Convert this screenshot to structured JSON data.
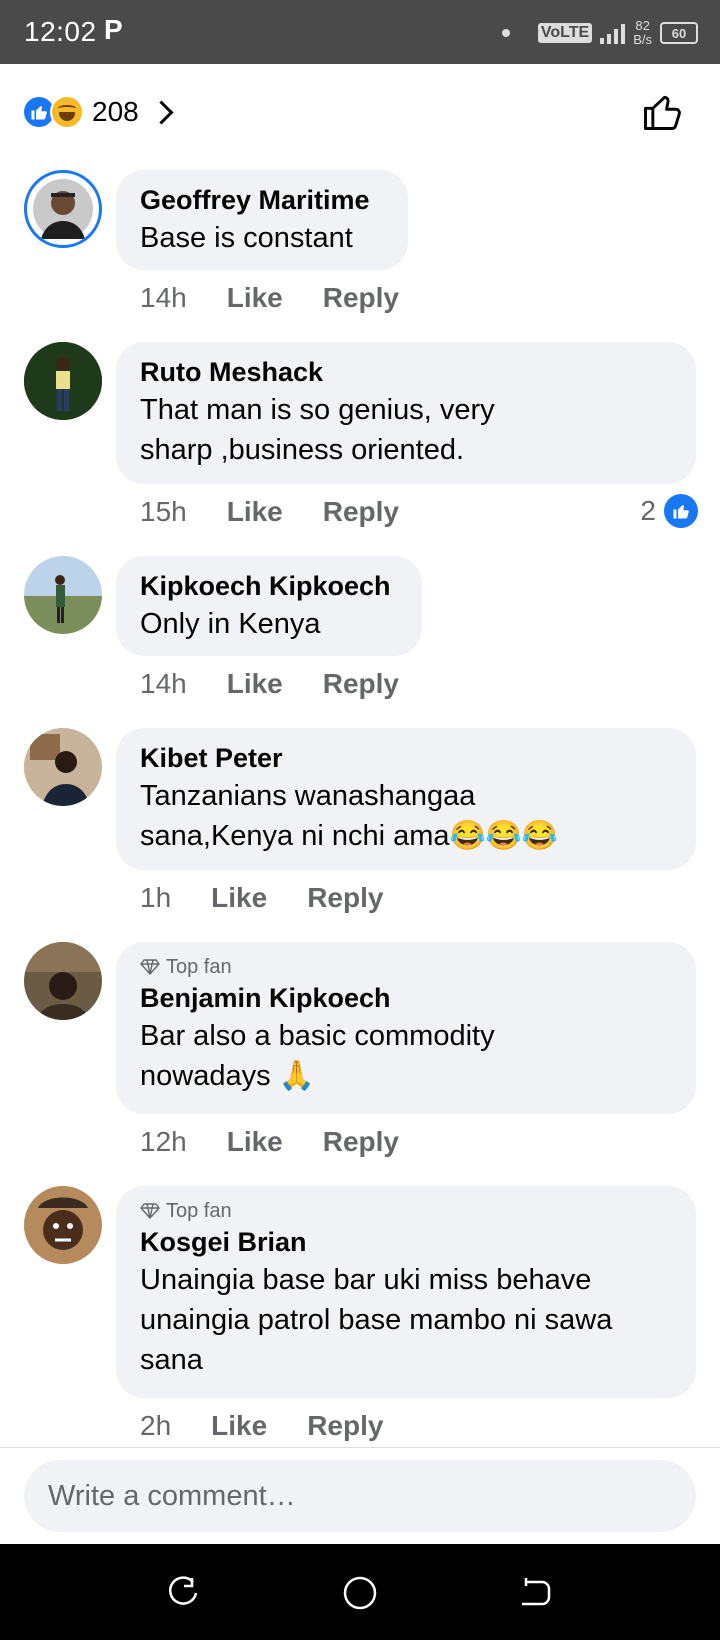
{
  "status_bar": {
    "time": "12:02",
    "app_indicator": "P",
    "volte": "VoLTE",
    "net_speed_value": "82",
    "net_speed_unit": "B/s",
    "battery": "60"
  },
  "reactions": {
    "count": "208",
    "icons": [
      "like-reaction-icon",
      "haha-reaction-icon"
    ]
  },
  "comments": [
    {
      "author": "Geoffrey Maritime",
      "text": "Base is constant",
      "time": "14h",
      "like": "Like",
      "reply": "Reply",
      "top_fan": ""
    },
    {
      "author": "Ruto Meshack",
      "text": "That man is so genius, very sharp ,business oriented.",
      "time": "15h",
      "like": "Like",
      "reply": "Reply",
      "likes": "2",
      "top_fan": ""
    },
    {
      "author": "Kipkoech Kipkoech",
      "text": "Only in Kenya",
      "time": "14h",
      "like": "Like",
      "reply": "Reply",
      "top_fan": ""
    },
    {
      "author": "Kibet Peter",
      "text": "Tanzanians wanashangaa sana,Kenya ni nchi ama😂😂😂",
      "time": "1h",
      "like": "Like",
      "reply": "Reply",
      "top_fan": ""
    },
    {
      "author": "Benjamin Kipkoech",
      "text": "Bar also a basic commodity nowadays 🙏",
      "time": "12h",
      "like": "Like",
      "reply": "Reply",
      "top_fan": "Top fan"
    },
    {
      "author": "Kosgei Brian",
      "text": "Unaingia base bar uki miss behave unaingia patrol base mambo ni sawa sana",
      "time": "2h",
      "like": "Like",
      "reply": "Reply",
      "top_fan": "Top fan"
    }
  ],
  "composer": {
    "placeholder": "Write a comment…"
  },
  "colors": {
    "accent": "#1877f2",
    "bubble": "#f0f2f5",
    "meta": "#65676b",
    "status_bar": "#4a4a4a",
    "nav_bar": "#000000"
  }
}
